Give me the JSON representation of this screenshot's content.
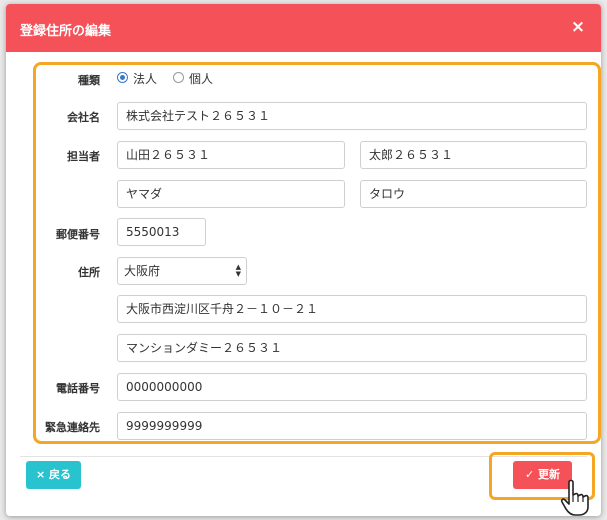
{
  "modal": {
    "title": "登録住所の編集",
    "close_icon": "×"
  },
  "form": {
    "type": {
      "label": "種類",
      "options": [
        {
          "label": "法人",
          "checked": true
        },
        {
          "label": "個人",
          "checked": false
        }
      ]
    },
    "company": {
      "label": "会社名",
      "value": "株式会社テスト２６５３１"
    },
    "contact": {
      "label": "担当者",
      "last_name": "山田２６５３１",
      "first_name": "太郎２６５３１",
      "last_name_kana": "ヤマダ",
      "first_name_kana": "タロウ"
    },
    "postal": {
      "label": "郵便番号",
      "value": "5550013"
    },
    "address": {
      "label": "住所",
      "prefecture": "大阪府",
      "line1": "大阪市西淀川区千舟２－１０－２１",
      "line2": "マンションダミー２６５３１"
    },
    "phone": {
      "label": "電話番号",
      "value": "0000000000"
    },
    "emergency": {
      "label": "緊急連絡先",
      "value": "9999999999"
    }
  },
  "footer": {
    "back_label": "戻る",
    "back_icon": "×",
    "update_label": "更新",
    "update_icon": "✓"
  },
  "colors": {
    "header": "#f45158",
    "highlight": "#f5a623",
    "back_button": "#28c3cf",
    "update_button": "#f45158"
  }
}
